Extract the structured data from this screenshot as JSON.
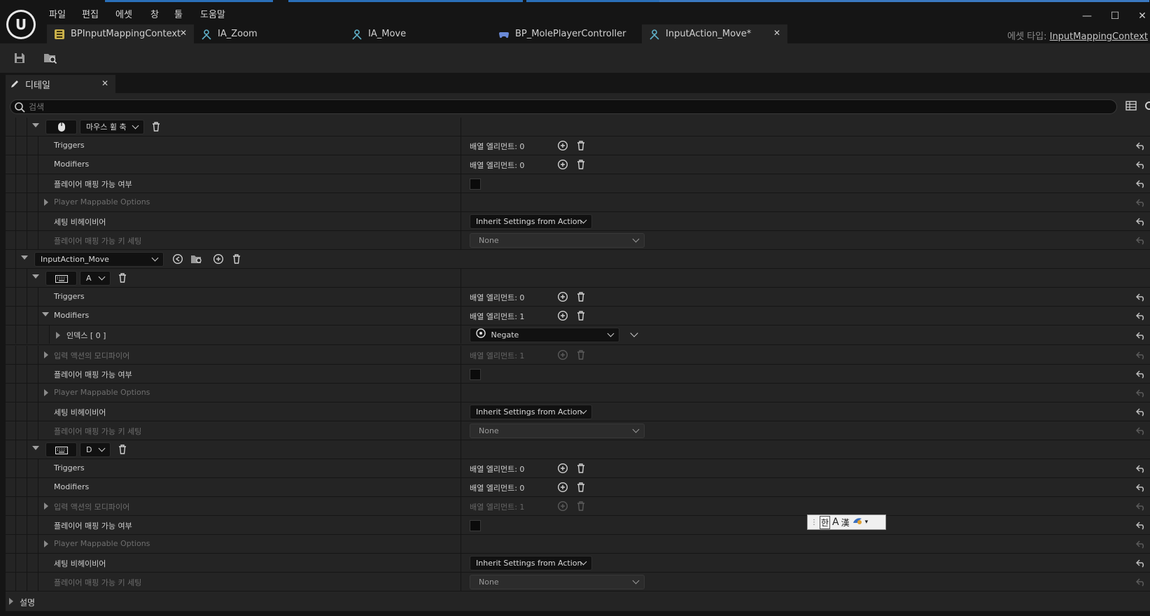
{
  "menu": [
    "파일",
    "편집",
    "에셋",
    "창",
    "툴",
    "도움말"
  ],
  "tabs": [
    {
      "label": "BPInputMappingContext",
      "icon": "input-mapping-context-icon"
    },
    {
      "label": "IA_Zoom",
      "icon": "input-action-icon"
    },
    {
      "label": "IA_Move",
      "icon": "input-action-icon"
    },
    {
      "label": "BP_MolePlayerController",
      "icon": "gamepad-icon"
    },
    {
      "label": "InputAction_Move*",
      "icon": "input-action-icon"
    }
  ],
  "asset_type": {
    "prefix": "에셋 타입:",
    "value": "InputMappingContext"
  },
  "panel": {
    "title": "디테일",
    "search_placeholder": "검색",
    "footer": "설명"
  },
  "labels": {
    "triggers": "Triggers",
    "modifiers": "Modifiers",
    "player_mappable": "플레이어 매핑 가능 여부",
    "player_mappable_options": "Player Mappable Options",
    "setting_behavior": "세팅 비헤이비어",
    "player_mappable_key_settings": "플레이어 매핑 가능 키 세팅",
    "input_action_modifiers": "입력 액션의 모디파이어",
    "index0": "인덱스 [ 0 ]"
  },
  "values": {
    "array0": "배열 엘리먼트: 0",
    "array1": "배열 엘리먼트: 1",
    "inherit": "Inherit Settings from Action",
    "none": "None",
    "negate": "Negate"
  },
  "mappings": {
    "mouse_key": "마우스 휠 축",
    "action": "InputAction_Move",
    "key_a": "A",
    "key_d": "D"
  },
  "ime": {
    "label": "한"
  }
}
